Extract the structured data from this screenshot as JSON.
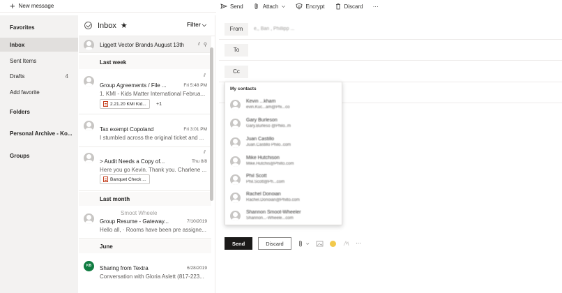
{
  "toolbar_left": {
    "new_message": "New message"
  },
  "toolbar_right": {
    "send": "Send",
    "attach": "Attach",
    "encrypt": "Encrypt",
    "discard": "Discard",
    "more": "···"
  },
  "nav": {
    "items": [
      {
        "label": "Favorites",
        "count": ""
      },
      {
        "label": "Inbox",
        "count": ""
      },
      {
        "label": "Sent Items",
        "count": ""
      },
      {
        "label": "Drafts",
        "count": "4"
      },
      {
        "label": "Add favorite",
        "count": ""
      },
      {
        "label": "Folders",
        "count": ""
      },
      {
        "label": "Personal Archive - Ko...",
        "count": ""
      },
      {
        "label": "Groups",
        "count": ""
      }
    ]
  },
  "list": {
    "title": "Inbox",
    "star": "★",
    "filter": "Filter",
    "top_message": {
      "text": "Liggett Vector Brands August 13th"
    },
    "sections": [
      "Last week",
      "Last month",
      "June"
    ],
    "messages": [
      {
        "sender": "",
        "subject": "Group Agreements / File ...",
        "date": "Fri 5:48 PM",
        "preview": "1. KMI - Kids Matter International Februa...",
        "attachment": "2.21.20 KMI Kid...",
        "extra": "+1"
      },
      {
        "sender": "",
        "subject": "Tax exempt Copoland",
        "date": "Fri 3:01 PM",
        "preview": "I stumbled across the original ticket and ...",
        "attachment": "",
        "extra": ""
      },
      {
        "sender": "",
        "subject": "> Audit Needs a Copy of...",
        "date": "Thu 8/8",
        "preview": "Here you go Kevin. Thank you. Charlene ...",
        "attachment": "Banquet Check ...",
        "extra": ""
      },
      {
        "sender": "Smoot Wheele",
        "subject": "Group Resume - Gateway...",
        "date": "7/10/2019",
        "preview": "Hello all, · Rooms have been pre assigne...",
        "attachment": "",
        "extra": ""
      },
      {
        "sender": "",
        "subject": "Sharing from Textra",
        "date": "6/28/2019",
        "preview": "Conversation with Gloria Aslett (817-223...",
        "attachment": "",
        "extra": "",
        "initials": "KB"
      }
    ]
  },
  "compose": {
    "from_label": "From",
    "from_value": "e,, Ban , Phillipp ...",
    "to_label": "To",
    "cc_label": "Cc",
    "contacts_header": "My contacts",
    "contacts": [
      {
        "name": "Kevin ...kham",
        "email": "evin.Kuc...am@Phi...co"
      },
      {
        "name": "Gary Burleson",
        "email": "Gary.Burleso @Philo..m"
      },
      {
        "name": "Juan Castillo",
        "email": "Juan.Castillo Philo..com"
      },
      {
        "name": "Mike Hutchison",
        "email": "Mike.Hutchis@Philto.com"
      },
      {
        "name": "Phil Scott",
        "email": "Phil.Scott@Ph...com"
      },
      {
        "name": "Rachel Donoian",
        "email": "Rachel.Donoian@Philto.com"
      },
      {
        "name": "Shannon Smoot-Wheeler",
        "email": "Shannon...-Wheele...com"
      }
    ],
    "send": "Send",
    "discard": "Discard",
    "more": "···"
  }
}
